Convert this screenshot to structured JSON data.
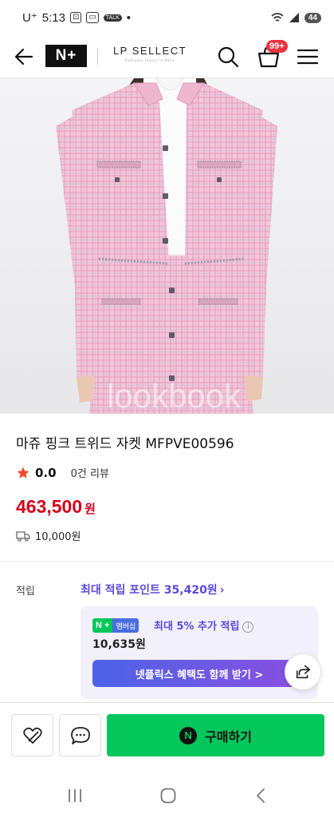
{
  "status_bar": {
    "carrier": "U⁺",
    "time": "5:13",
    "battery": "44"
  },
  "header": {
    "logo_text": "N+",
    "brand_name": "LP SELLECT",
    "brand_tagline": "Find your luxury in Paris",
    "cart_badge": "99+"
  },
  "product": {
    "watermark": "lookbook",
    "title": "마쥬 핑크 트위드 자켓 MFPVE00596",
    "rating": "0.0",
    "review_count": "0건 리뷰",
    "price": "463,500",
    "price_unit": "원",
    "shipping_fee": "10,000원"
  },
  "points": {
    "label": "적립",
    "max_points": "최대 적립 포인트 35,420원",
    "np_logo": "N +",
    "np_membership": "멤버십",
    "np_max_rate": "최대 5% 추가 적립",
    "np_amount": "10,635원",
    "np_benefit_button": "넷플릭스 혜택도 함께 받기 >"
  },
  "bottom_bar": {
    "buy_label": "구매하기",
    "buy_icon_letter": "N"
  },
  "colors": {
    "price_red": "#d0021b",
    "points_purple": "#5b4bd8",
    "naver_green": "#03c75a",
    "badge_red": "#e8343f"
  },
  "icons": [
    "back-arrow-icon",
    "search-icon",
    "cart-icon",
    "hamburger-menu-icon",
    "star-icon",
    "truck-icon",
    "info-icon",
    "share-icon",
    "heart-icon",
    "chat-bubble-icon",
    "recent-apps-icon",
    "home-icon",
    "nav-back-icon"
  ]
}
